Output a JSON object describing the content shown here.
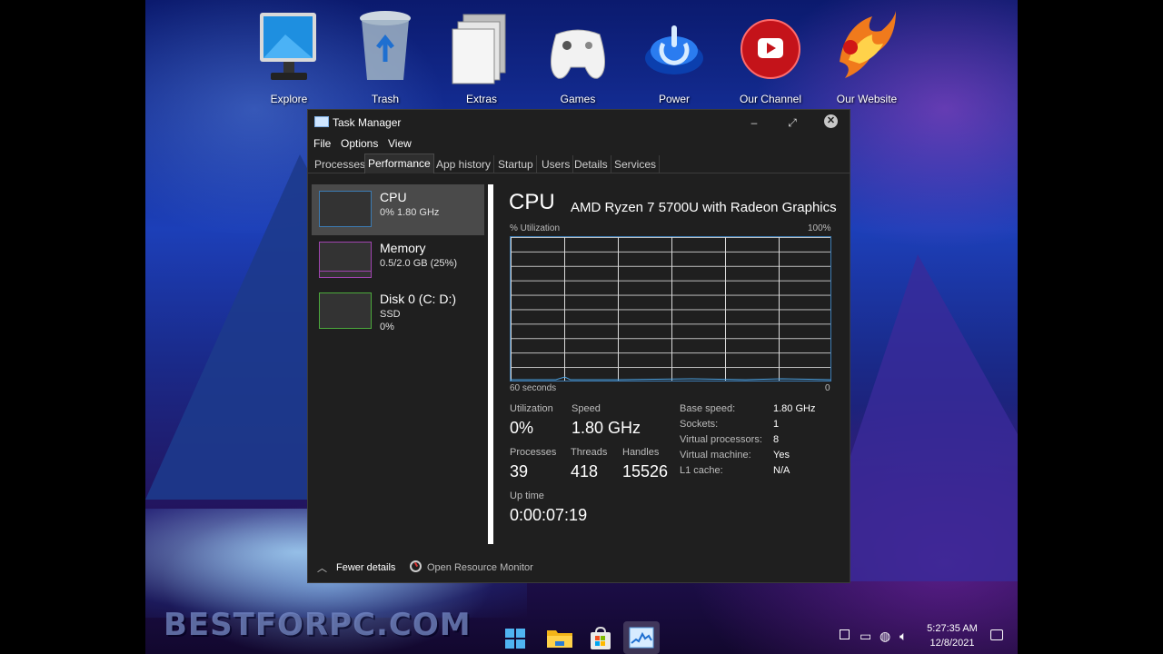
{
  "desktop_icons": [
    {
      "label": "Explore",
      "icon": "monitor-icon"
    },
    {
      "label": "Trash",
      "icon": "recycle-bin-icon"
    },
    {
      "label": "Extras",
      "icon": "folder-icon"
    },
    {
      "label": "Games",
      "icon": "gamepad-icon"
    },
    {
      "label": "Power",
      "icon": "power-icon"
    },
    {
      "label": "Our Channel",
      "icon": "youtube-icon"
    },
    {
      "label": "Our Website",
      "icon": "phoenix-icon"
    }
  ],
  "watermark": "BESTFORPC.COM",
  "task_manager": {
    "title": "Task Manager",
    "window_controls": {
      "minimize": "–",
      "maximize": "⤢",
      "close": "✕"
    },
    "menu": [
      "File",
      "Options",
      "View"
    ],
    "tabs": [
      "Processes",
      "Performance",
      "App history",
      "Startup",
      "Users",
      "Details",
      "Services"
    ],
    "active_tab": "Performance",
    "resources": [
      {
        "name": "CPU",
        "lines": [
          "0% 1.80 GHz"
        ],
        "color": "#3c7bb3",
        "selected": true
      },
      {
        "name": "Memory",
        "lines": [
          "0.5/2.0 GB (25%)"
        ],
        "color": "#a044b0",
        "selected": false
      },
      {
        "name": "Disk 0 (C: D:)",
        "lines": [
          "SSD",
          "0%"
        ],
        "color": "#4caa3c",
        "selected": false
      }
    ],
    "detail": {
      "heading": "CPU",
      "model": "AMD Ryzen 7 5700U with Radeon Graphics",
      "graph_top_left": "% Utilization",
      "graph_top_right": "100%",
      "graph_bottom_left": "60 seconds",
      "graph_bottom_right": "0",
      "graph_color": "#3c7bb3",
      "stats": {
        "utilization_label": "Utilization",
        "utilization": "0%",
        "speed_label": "Speed",
        "speed": "1.80 GHz",
        "processes_label": "Processes",
        "processes": "39",
        "threads_label": "Threads",
        "threads": "418",
        "handles_label": "Handles",
        "handles": "15526",
        "uptime_label": "Up time",
        "uptime": "0:00:07:19"
      },
      "specs": [
        {
          "key": "Base speed:",
          "value": "1.80 GHz"
        },
        {
          "key": "Sockets:",
          "value": "1"
        },
        {
          "key": "Virtual processors:",
          "value": "8"
        },
        {
          "key": "Virtual machine:",
          "value": "Yes"
        },
        {
          "key": "L1 cache:",
          "value": "N/A"
        }
      ]
    },
    "footer": {
      "fewer_details": "Fewer details",
      "open_resource_monitor": "Open Resource Monitor"
    }
  },
  "taskbar": {
    "apps": [
      "start-icon",
      "file-explorer-icon",
      "store-icon",
      "task-manager-icon"
    ],
    "tray_icons": [
      "notification-square-icon",
      "battery-icon",
      "network-icon",
      "volume-icon"
    ],
    "time": "5:27:35 AM",
    "date": "12/8/2021"
  }
}
